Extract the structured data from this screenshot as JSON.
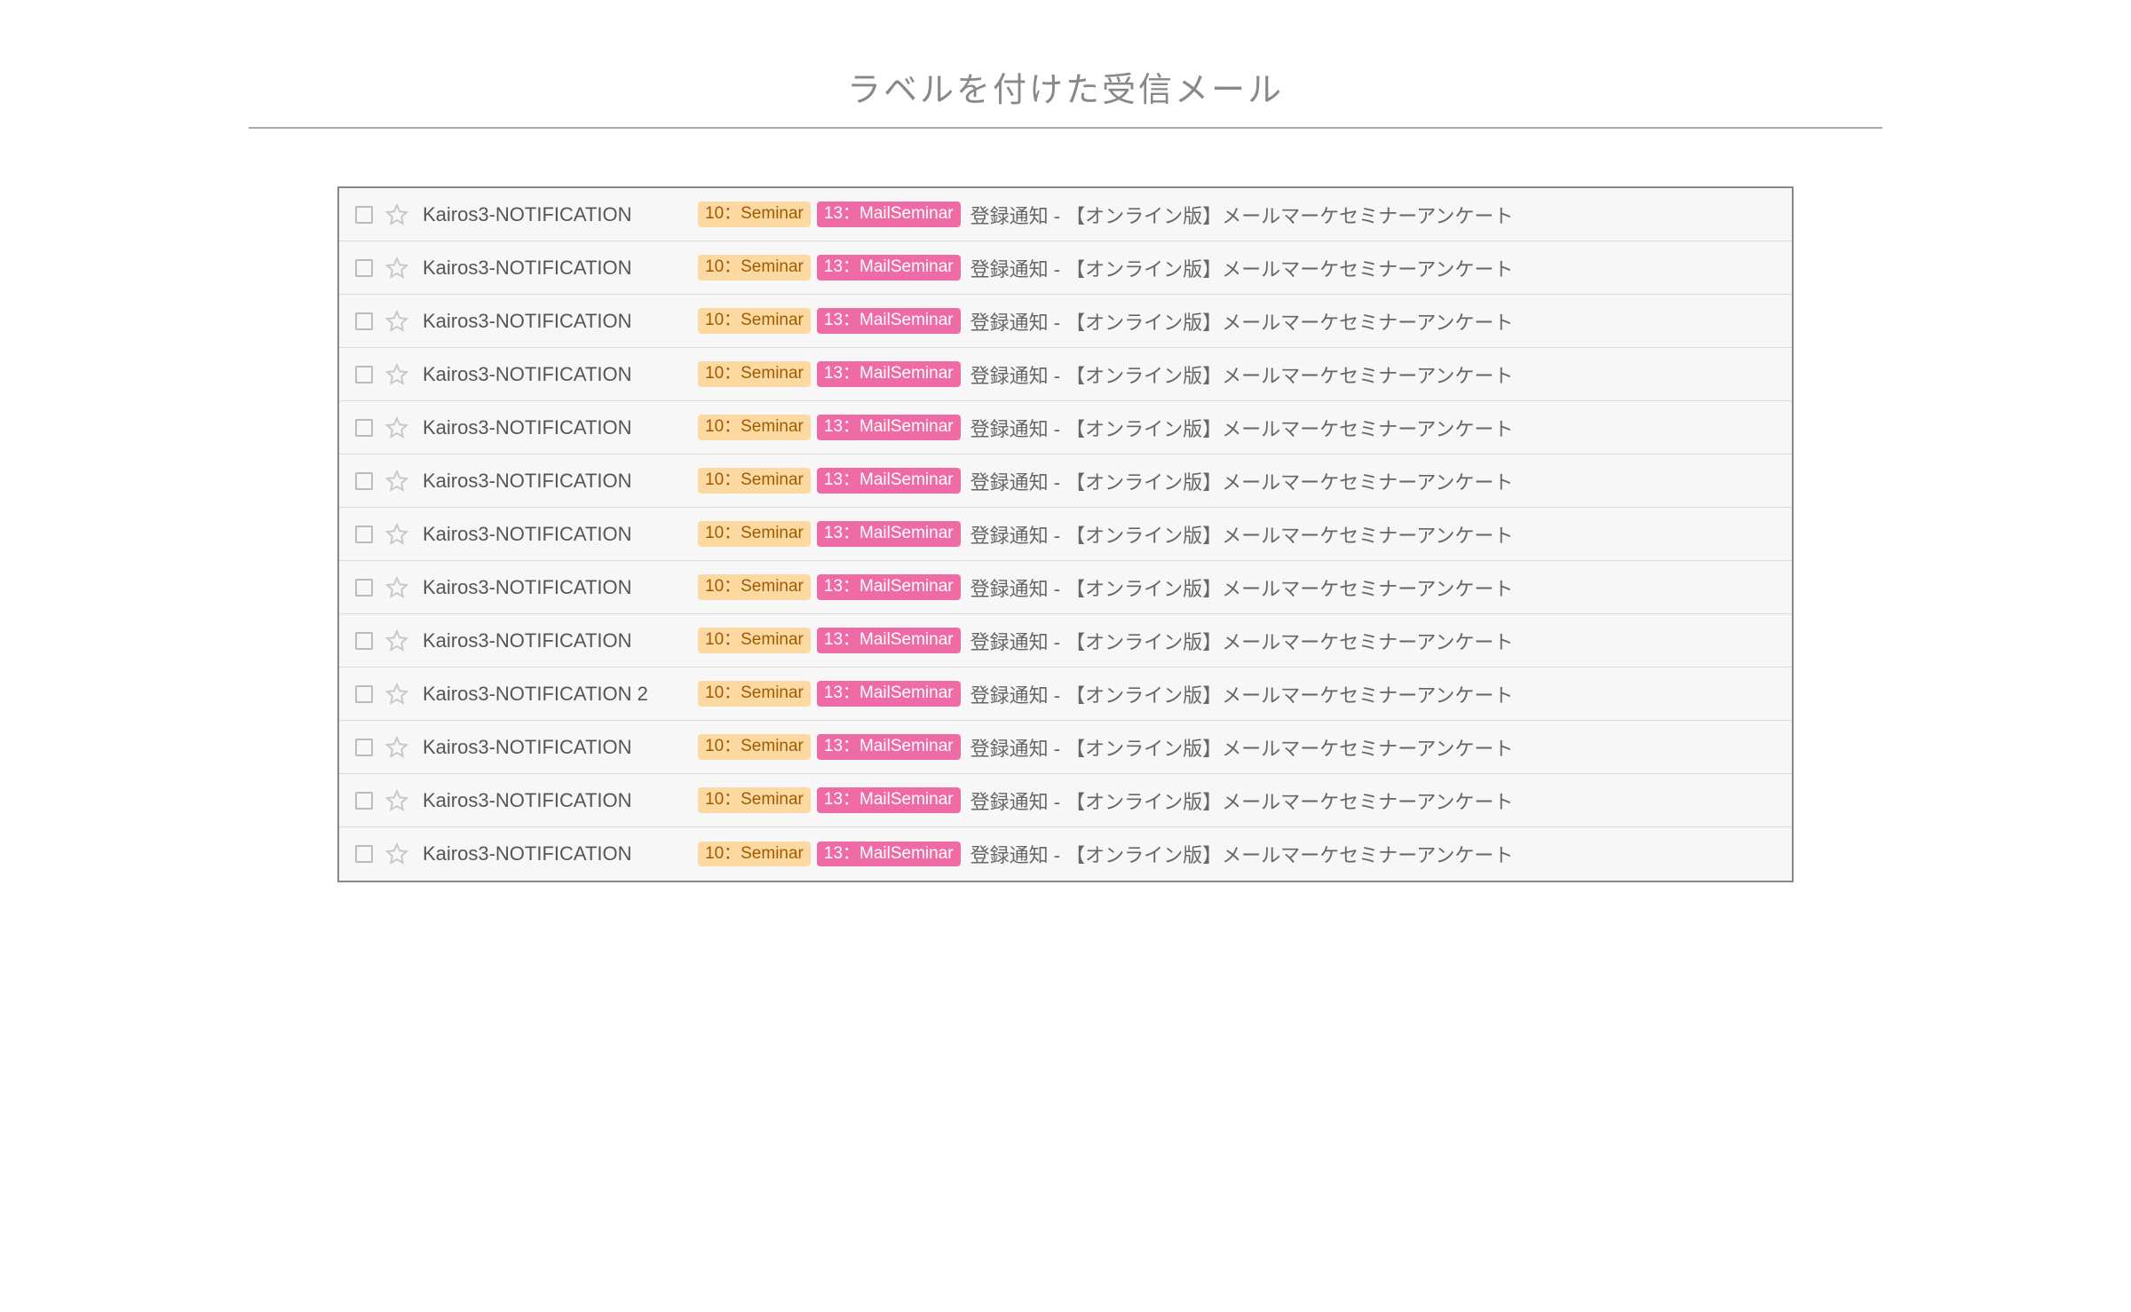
{
  "heading": "ラベルを付けた受信メール",
  "label1_text": "10：Seminar",
  "label2_text": "13：MailSeminar",
  "subject_text": "登録通知 - 【オンライン版】メールマーケセミナーアンケート",
  "rows": [
    {
      "sender": "Kairos3-NOTIFICATION"
    },
    {
      "sender": "Kairos3-NOTIFICATION"
    },
    {
      "sender": "Kairos3-NOTIFICATION"
    },
    {
      "sender": "Kairos3-NOTIFICATION"
    },
    {
      "sender": "Kairos3-NOTIFICATION"
    },
    {
      "sender": "Kairos3-NOTIFICATION"
    },
    {
      "sender": "Kairos3-NOTIFICATION"
    },
    {
      "sender": "Kairos3-NOTIFICATION"
    },
    {
      "sender": "Kairos3-NOTIFICATION"
    },
    {
      "sender": "Kairos3-NOTIFICATION 2"
    },
    {
      "sender": "Kairos3-NOTIFICATION"
    },
    {
      "sender": "Kairos3-NOTIFICATION"
    },
    {
      "sender": "Kairos3-NOTIFICATION"
    }
  ]
}
